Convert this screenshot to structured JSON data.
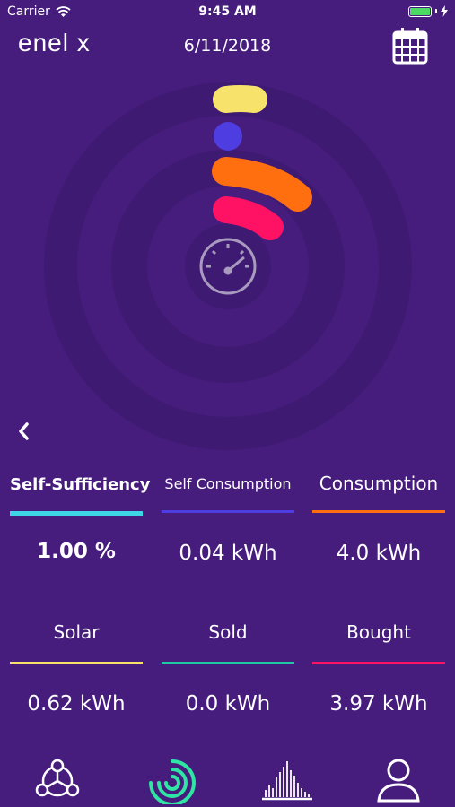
{
  "status_bar": {
    "carrier": "Carrier",
    "time": "9:45 AM"
  },
  "header": {
    "logo": "enel x",
    "date": "6/11/2018"
  },
  "colors": {
    "background": "#461c7c",
    "self_sufficiency": "#3fd7e8",
    "self_consumption": "#4e3de0",
    "consumption": "#ff6f10",
    "solar": "#f7e26b",
    "sold": "#20c9a2",
    "bought": "#ff1264",
    "nav_active": "#2fe5a3"
  },
  "metrics": {
    "self_sufficiency": {
      "label": "Self-Sufficiency",
      "value": "1.00 %"
    },
    "self_consumption": {
      "label": "Self Consumption",
      "value": "0.04 kWh"
    },
    "consumption": {
      "label": "Consumption",
      "value": "4.0 kWh"
    },
    "solar": {
      "label": "Solar",
      "value": "0.62 kWh"
    },
    "sold": {
      "label": "Sold",
      "value": "0.0 kWh"
    },
    "bought": {
      "label": "Bought",
      "value": "3.97 kWh"
    }
  },
  "bottom_nav": [
    "network-icon",
    "energy-ring-icon",
    "histogram-icon",
    "profile-icon"
  ]
}
